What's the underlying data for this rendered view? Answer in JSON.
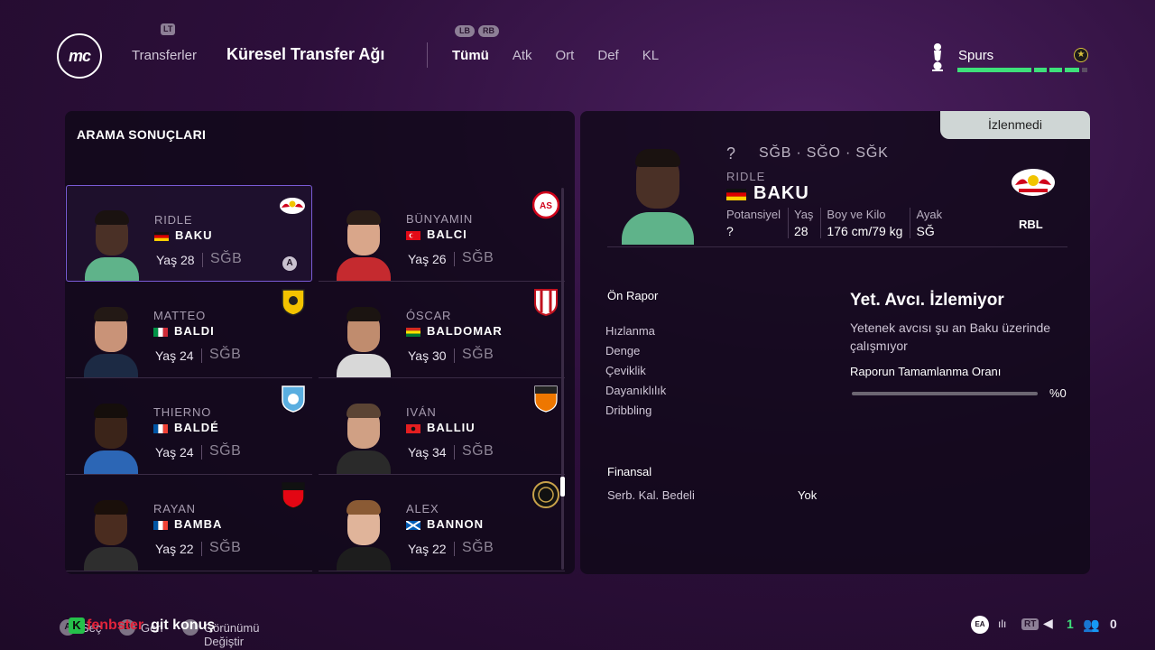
{
  "header": {
    "logo_text": "mc",
    "lt_hint": "LT",
    "lb_hint": "LB",
    "rb_hint": "RB",
    "prev_section": "Transferler",
    "title": "Küresel Transfer Ağı",
    "filter_tabs": [
      "Tümü",
      "Atk",
      "Ort",
      "Def",
      "KL"
    ],
    "active_tab": "Tümü",
    "club_name": "Spurs",
    "club_crest_icon": "cockerel-crest-icon",
    "club_rating_icon": "star-icon"
  },
  "search_results": {
    "title": "ARAMA SONUÇLARI",
    "players": [
      {
        "first": "RIDLE",
        "last": "BAKU",
        "age": "Yaş 28",
        "pos": "SĞB",
        "flag": "de",
        "club": "RBL",
        "badge": "A",
        "skin": "#4a3026",
        "hair": "#1a1210",
        "shirt": "#5fb38a"
      },
      {
        "first": "BÜNYAMIN",
        "last": "BALCI",
        "age": "Yaş 26",
        "pos": "SĞB",
        "flag": "tr",
        "club": "Antalyaspor",
        "skin": "#d9a68a",
        "hair": "#2a1d17",
        "shirt": "#c52a2f"
      },
      {
        "first": "MATTEO",
        "last": "BALDI",
        "age": "Yaş 24",
        "pos": "SĞB",
        "flag": "it",
        "club": "Juve Stabia",
        "skin": "#c99378",
        "hair": "#231915",
        "shirt": "#1c2a44"
      },
      {
        "first": "ÓSCAR",
        "last": "BALDOMAR",
        "age": "Yaş 30",
        "pos": "SĞB",
        "flag": "bo",
        "club": "Nacional Potosí",
        "skin": "#c08c6e",
        "hair": "#1b1411",
        "shirt": "#d8d8d8"
      },
      {
        "first": "THIERNO",
        "last": "BALDÉ",
        "age": "Yaş 24",
        "pos": "SĞB",
        "flag": "fr",
        "club": "Troyes",
        "skin": "#3b2419",
        "hair": "#150e0b",
        "shirt": "#2c66b5"
      },
      {
        "first": "IVÁN",
        "last": "BALLIU",
        "age": "Yaş 34",
        "pos": "SĞB",
        "flag": "al",
        "club": "Lorient",
        "skin": "#d0a084",
        "hair": "#5b4434",
        "shirt": "#2a2a2a"
      },
      {
        "first": "RAYAN",
        "last": "BAMBA",
        "age": "Yaş 22",
        "pos": "SĞB",
        "flag": "fr",
        "club": "Rennes",
        "skin": "#4a2c1f",
        "hair": "#1a0f0a",
        "shirt": "#2e2e2e"
      },
      {
        "first": "ALEX",
        "last": "BANNON",
        "age": "Yaş 22",
        "pos": "SĞB",
        "flag": "sco",
        "club": "Aberdeen",
        "skin": "#e0b49a",
        "hair": "#8a5a34",
        "shirt": "#1d1d1d"
      }
    ]
  },
  "detail": {
    "watch_status": "İzlenmedi",
    "potential_q": "?",
    "positions": "SĞB · SĞO · SĞK",
    "first_name": "RIDLE",
    "last_name": "BAKU",
    "flag": "de",
    "stats": [
      {
        "label": "Potansiyel",
        "value": "?"
      },
      {
        "label": "Yaş",
        "value": "28"
      },
      {
        "label": "Boy ve Kilo",
        "value": "176 cm/79 kg"
      },
      {
        "label": "Ayak",
        "value": "SĞ"
      }
    ],
    "club_abbr": "RBL",
    "club_crest_icon": "red-bull-crest-icon",
    "report_title": "Ön Rapor",
    "attributes": [
      "Hızlanma",
      "Denge",
      "Çeviklik",
      "Dayanıklılık",
      "Dribbling"
    ],
    "scout_title": "Yet. Avcı. İzlemiyor",
    "scout_desc": "Yetenek avcısı şu an Baku üzerinde çalışmıyor",
    "report_rate_label": "Raporun Tamamlanma Oranı",
    "report_rate_value": 0,
    "report_rate_text": "%0",
    "finance_title": "Finansal",
    "release_clause_label": "Serb. Kal. Bedeli",
    "release_clause_value": "Yok"
  },
  "bottom": {
    "hint_a": "A",
    "hint_a_label": "Seç",
    "hint_b": "B",
    "hint_b_label": "Geri",
    "hint_view": "Görünümü Değiştir",
    "overlay_k": "K",
    "overlay_red": "fenbster",
    "overlay_white": "git konuş",
    "tray_ea": "EA",
    "tray_rt": "RT",
    "tray_one": "1",
    "tray_zero": "0"
  },
  "colors": {
    "accent_green": "#3ee07a",
    "selected_border": "#7a5bd6",
    "panel_bg": "#100818"
  }
}
